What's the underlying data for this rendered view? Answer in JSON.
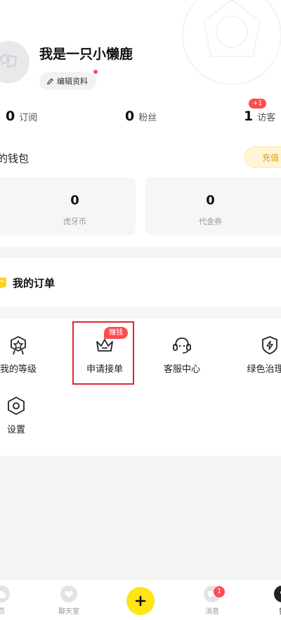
{
  "profile": {
    "username": "我是一只小懒鹿",
    "edit_label": "编辑资料"
  },
  "stats": [
    {
      "value": "0",
      "label": "订阅"
    },
    {
      "value": "0",
      "label": "粉丝"
    },
    {
      "value": "1",
      "label": "访客",
      "badge": "+1"
    }
  ],
  "wallet": {
    "title": "的钱包",
    "recharge_label": "充值",
    "cards": [
      {
        "value": "0",
        "label": "虎牙币"
      },
      {
        "value": "0",
        "label": "代金券"
      }
    ]
  },
  "orders": {
    "title": "我的订单"
  },
  "tools": {
    "items": [
      {
        "label": "我的等级",
        "icon": "level-badge-icon"
      },
      {
        "label": "申请接单",
        "icon": "crown-icon",
        "badge": "赚钱"
      },
      {
        "label": "客服中心",
        "icon": "headset-icon"
      },
      {
        "label": "绿色治理平",
        "icon": "shield-bolt-icon"
      },
      {
        "label": "设置",
        "icon": "settings-hexagon-icon"
      }
    ]
  },
  "tabbar": {
    "items": [
      {
        "label": "页",
        "icon": "home-icon"
      },
      {
        "label": "聊天室",
        "icon": "heart-chat-icon"
      },
      {
        "label": "",
        "icon": "plus-icon"
      },
      {
        "label": "消息",
        "icon": "message-icon",
        "badge": "1"
      },
      {
        "label": "我",
        "icon": "profile-icon"
      }
    ]
  },
  "colors": {
    "accent_yellow": "#ffe512",
    "badge_red": "#ff4d4f",
    "highlight_red": "#e0262c",
    "recharge_text": "#e59a00"
  }
}
